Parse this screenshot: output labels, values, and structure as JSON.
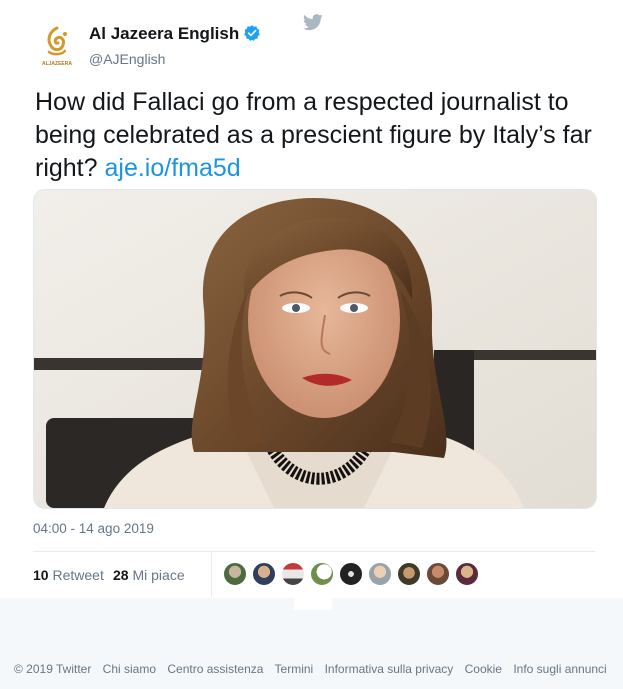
{
  "author": {
    "name": "Al Jazeera English",
    "handle": "@AJEnglish",
    "logo_caption": "ALJAZEERA",
    "verified": true
  },
  "tweet": {
    "text": "How did Fallaci go from a respected journalist to being celebrated as a prescient figure by Italy’s far right?",
    "link": "aje.io/fma5d",
    "image": "Portrait photo of a woman with shoulder-length hair, dark necklace and cream jacket"
  },
  "meta": {
    "timestamp": "04:00 - 14 ago 2019"
  },
  "stats": {
    "retweets_count": "10",
    "retweets_label": "Retweet",
    "likes_count": "28",
    "likes_label": "Mi piace"
  },
  "footer": {
    "links": [
      "© 2019 Twitter",
      "Chi siamo",
      "Centro assistenza",
      "Termini",
      "Informativa sulla privacy",
      "Cookie",
      "Info sugli annunci"
    ]
  },
  "colors": {
    "link": "#1b95e0",
    "secondary_text": "#657786",
    "verified": "#1da1f2",
    "footer_bg": "#f5f8fa"
  }
}
